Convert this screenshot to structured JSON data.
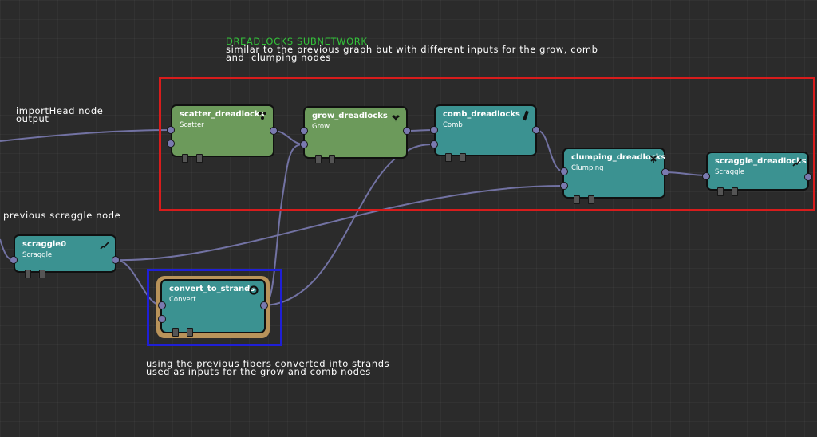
{
  "annotations": {
    "subnetwork_title": "DREADLOCKS SUBNETWORK",
    "subnetwork_line1": "similar to the previous graph but with different inputs for the grow, comb",
    "subnetwork_line2": "and  clumping nodes",
    "import_line1": "importHead node",
    "import_line2": "output",
    "previous_scraggle": "previous scraggle node",
    "convert_line1": "using the previous fibers converted into strands",
    "convert_line2": "used as inputs for the grow and comb nodes"
  },
  "colors": {
    "background": "#2b2b2b",
    "node_green": "#6c9a5b",
    "node_teal": "#3b9291",
    "selection_halo": "#b9935a",
    "wire": "#7a7ab0",
    "frame_red": "#d81c1c",
    "frame_blue": "#1f1fd6",
    "annotation_title": "#33c23a"
  },
  "nodes": {
    "scatter": {
      "name": "scatter_dreadlocks",
      "type": "Scatter",
      "icon": "dots-icon"
    },
    "grow": {
      "name": "grow_dreadlocks",
      "type": "Grow",
      "icon": "leaf-icon"
    },
    "comb": {
      "name": "comb_dreadlocks",
      "type": "Comb",
      "icon": "comb-icon"
    },
    "clumping": {
      "name": "clumping_dreadlocks",
      "type": "Clumping",
      "icon": "clump-icon"
    },
    "scraggle_dread": {
      "name": "scraggle_dreadlocks",
      "type": "Scraggle",
      "icon": "scraggle-icon"
    },
    "scraggle0": {
      "name": "scraggle0",
      "type": "Scraggle",
      "icon": "scraggle-icon"
    },
    "convert": {
      "name": "convert_to_strands",
      "type": "Convert",
      "icon": "convert-ring-icon"
    }
  }
}
